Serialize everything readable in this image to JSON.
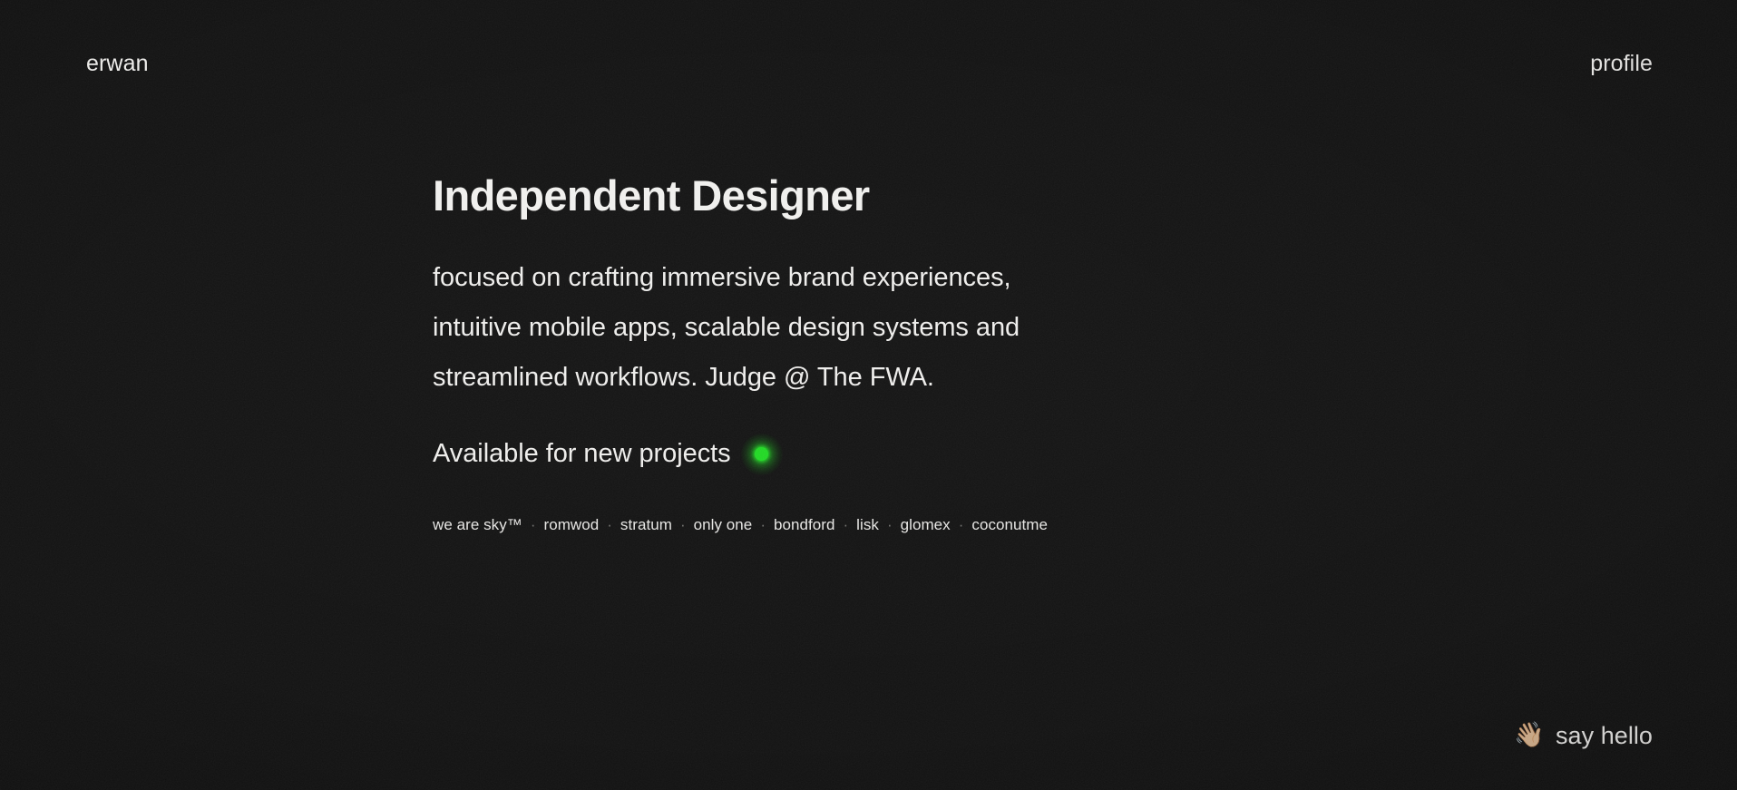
{
  "theme": {
    "background": "#111111",
    "text": "#eeedeb",
    "muted": "#6f6f6c",
    "accent_green": "#1fd822"
  },
  "header": {
    "brand": "erwan",
    "nav": {
      "profile_label": "profile"
    }
  },
  "main": {
    "headline": "Independent Designer",
    "intro": "focused on crafting immersive brand experiences, intuitive mobile apps, scalable design systems and streamlined workflows. Judge @ The FWA.",
    "intro_lines": [
      "focused on crafting immersive brand experiences,",
      "intuitive mobile apps, scalable design systems and",
      "streamlined workflows. Judge @ The FWA."
    ],
    "availability": {
      "label": "Available for new projects",
      "status": "available",
      "dot_color": "#1fd822"
    },
    "clients": {
      "separator": "·",
      "items": [
        {
          "name": "we are sky™"
        },
        {
          "name": "romwod"
        },
        {
          "name": "stratum"
        },
        {
          "name": "only one"
        },
        {
          "name": "bondford"
        },
        {
          "name": "lisk"
        },
        {
          "name": "glomex"
        },
        {
          "name": "coconutme"
        }
      ]
    }
  },
  "footer": {
    "contact": {
      "emoji": "👋🏼",
      "label": "say hello"
    }
  }
}
